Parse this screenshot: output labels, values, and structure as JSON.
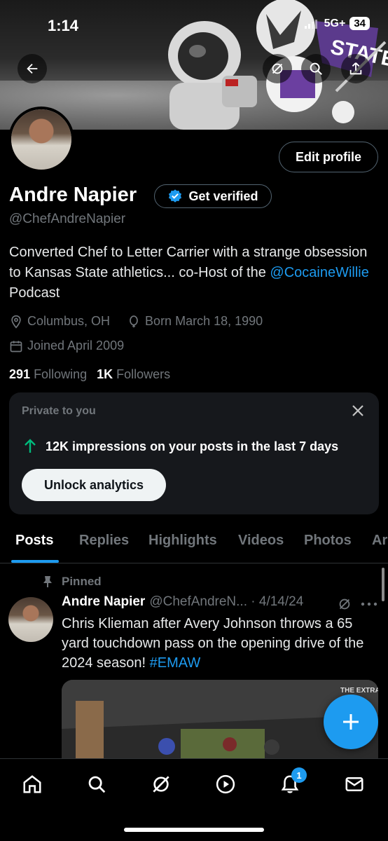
{
  "status": {
    "time": "1:14",
    "network": "5G+",
    "battery": "34"
  },
  "profile": {
    "name": "Andre Napier",
    "handle": "@ChefAndreNapier",
    "edit_label": "Edit profile",
    "verify_label": "Get verified",
    "bio_text": "Converted Chef to Letter Carrier with a strange obsession to Kansas State athletics... co-Host of the ",
    "bio_link": "@CocaineWillie",
    "bio_tail": " Podcast",
    "location": "Columbus, OH",
    "birthday": "Born March 18, 1990",
    "joined": "Joined April 2009",
    "following_count": "291",
    "following_label": "Following",
    "followers_count": "1K",
    "followers_label": "Followers"
  },
  "analytics_card": {
    "title": "Private to you",
    "stat": "12K impressions on your posts in the last 7 days",
    "button": "Unlock analytics"
  },
  "tabs": [
    {
      "label": "Posts",
      "active": true
    },
    {
      "label": "Replies"
    },
    {
      "label": "Highlights"
    },
    {
      "label": "Videos"
    },
    {
      "label": "Photos"
    },
    {
      "label": "Ar"
    }
  ],
  "post": {
    "pinned_label": "Pinned",
    "author": "Andre Napier",
    "handle_date": "@ChefAndreN... · 4/14/24",
    "text": "Chris Klieman after Avery Johnson throws a 65 yard touchdown pass on the opening drive of the 2024 season! ",
    "hashtag": "#EMAW",
    "media_label": "THE EXTRA"
  },
  "nav": {
    "notification_count": "1"
  },
  "colors": {
    "accent": "#1d9bf0",
    "background": "#000000",
    "muted": "#71767b",
    "card": "#16181c"
  }
}
